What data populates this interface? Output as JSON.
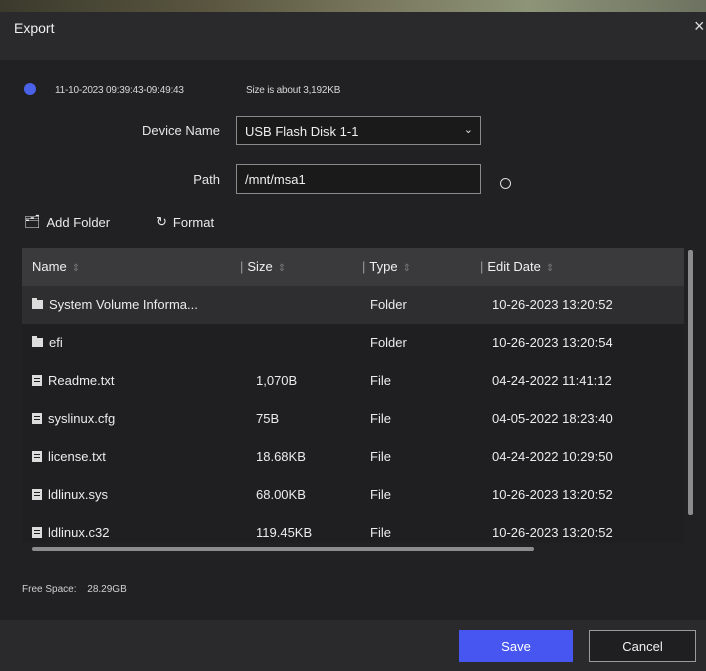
{
  "dialog": {
    "title": "Export",
    "close_glyph": "×"
  },
  "info": {
    "time_range": "11-10-2023 09:39:43-09:49:43",
    "size_text": "Size is about 3,192KB"
  },
  "form": {
    "device_name_label": "Device Name",
    "device_name_value": "USB Flash Disk 1-1",
    "path_label": "Path",
    "path_value": "/mnt/msa1"
  },
  "toolbar": {
    "add_folder_label": "Add Folder",
    "format_label": "Format"
  },
  "table": {
    "headers": [
      "Name",
      "Size",
      "Type",
      "Edit Date"
    ],
    "rows": [
      {
        "name": "System Volume Informa...",
        "size": "",
        "type": "Folder",
        "date": "10-26-2023 13:20:52",
        "icon": "folder-icon"
      },
      {
        "name": "efi",
        "size": "",
        "type": "Folder",
        "date": "10-26-2023 13:20:54",
        "icon": "folder-icon"
      },
      {
        "name": "Readme.txt",
        "size": "1,070B",
        "type": "File",
        "date": "04-24-2022 11:41:12",
        "icon": "file-icon"
      },
      {
        "name": "syslinux.cfg",
        "size": "75B",
        "type": "File",
        "date": "04-05-2022 18:23:40",
        "icon": "file-icon"
      },
      {
        "name": "license.txt",
        "size": "18.68KB",
        "type": "File",
        "date": "04-24-2022 10:29:50",
        "icon": "file-icon"
      },
      {
        "name": "ldlinux.sys",
        "size": "68.00KB",
        "type": "File",
        "date": "10-26-2023 13:20:52",
        "icon": "file-icon"
      },
      {
        "name": "ldlinux.c32",
        "size": "119.45KB",
        "type": "File",
        "date": "10-26-2023 13:20:52",
        "icon": "file-icon"
      }
    ]
  },
  "free_space": {
    "label": "Free Space:",
    "value": "28.29GB"
  },
  "buttons": {
    "save": "Save",
    "cancel": "Cancel"
  },
  "colors": {
    "accent": "#4756f0",
    "info_icon": "#4a62e8"
  }
}
